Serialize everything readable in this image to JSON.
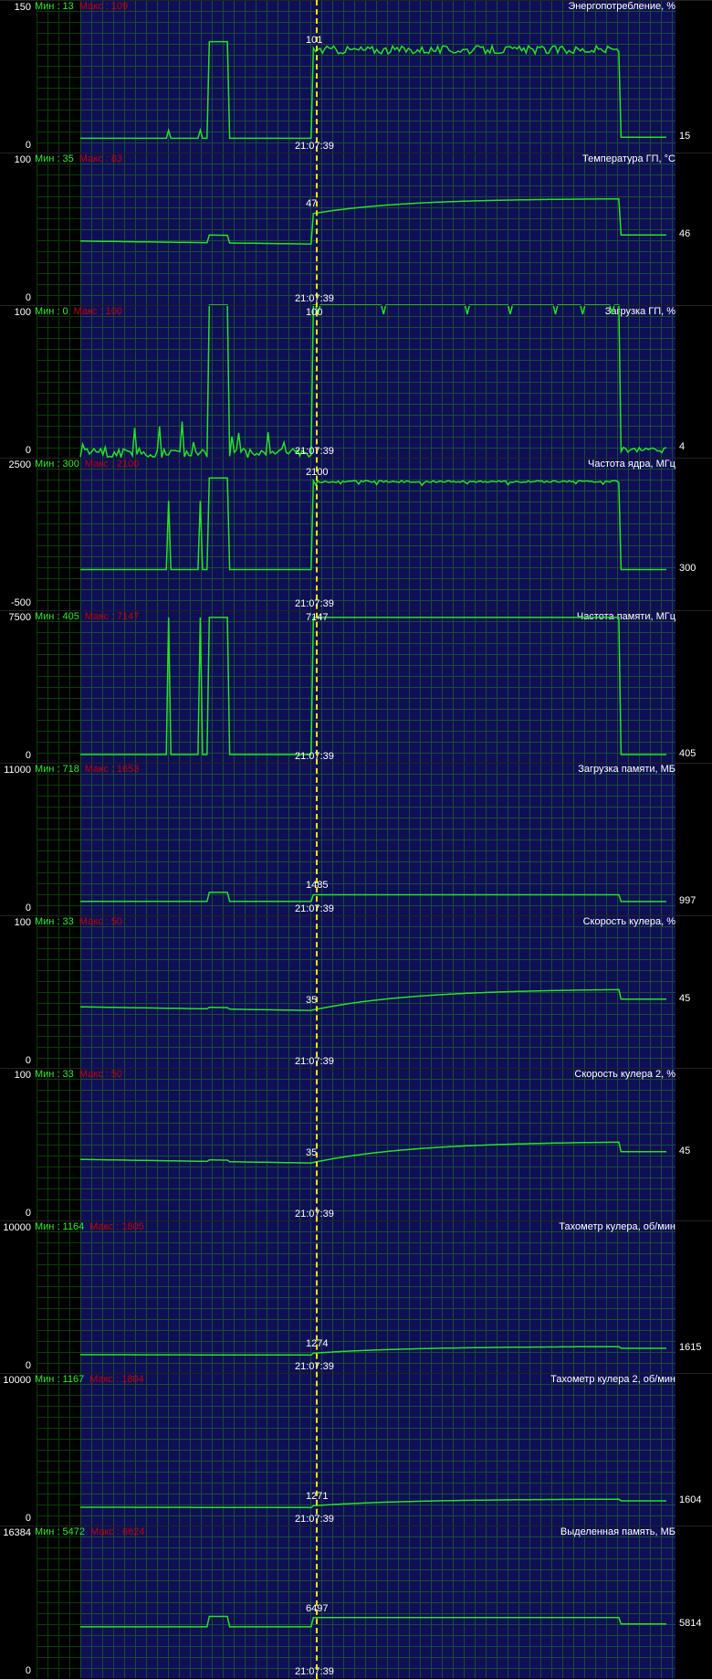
{
  "time_label": "21:07:39",
  "colors": {
    "line": "#24e224",
    "cursor": "#f2e600",
    "min": "#2ee82e",
    "max": "#c00000"
  },
  "panels": [
    {
      "key": "power",
      "title": "Энергопотребление, %",
      "min_label": "Мин : 13",
      "max_label": "Макс : 109",
      "ymax": "150",
      "ymin": "0",
      "current": "15",
      "cursor_value": "101",
      "scale": [
        0,
        150
      ],
      "profile": "power"
    },
    {
      "key": "temp",
      "title": "Температура ГП, °C",
      "min_label": "Мин : 35",
      "max_label": "Макс : 83",
      "ymax": "100",
      "ymin": "0",
      "current": "46",
      "cursor_value": "47",
      "scale": [
        0,
        100
      ],
      "profile": "temp"
    },
    {
      "key": "gpuload",
      "title": "Загрузка ГП, %",
      "min_label": "Мин : 0",
      "max_label": "Макс : 100",
      "ymax": "100",
      "ymin": "0",
      "current": "4",
      "cursor_value": "100",
      "scale": [
        0,
        100
      ],
      "profile": "gpuload"
    },
    {
      "key": "coreclk",
      "title": "Частота ядра, МГц",
      "min_label": "Мин : 300",
      "max_label": "Макс : 2100",
      "ymax": "2500",
      "ymin": "-500",
      "current": "300",
      "cursor_value": "2100",
      "scale": [
        -500,
        2500
      ],
      "profile": "coreclk"
    },
    {
      "key": "memclk",
      "title": "Частота памяти, МГц",
      "min_label": "Мин : 405",
      "max_label": "Макс : 7147",
      "ymax": "7500",
      "ymin": "0",
      "current": "405",
      "cursor_value": "7147",
      "scale": [
        0,
        7500
      ],
      "profile": "memclk"
    },
    {
      "key": "memload",
      "title": "Загрузка памяти, МБ",
      "min_label": "Мин : 718",
      "max_label": "Макс : 1653",
      "ymax": "11000",
      "ymin": "0",
      "current": "997",
      "cursor_value": "1485",
      "scale": [
        0,
        11000
      ],
      "profile": "memload"
    },
    {
      "key": "fan1",
      "title": "Скорость кулера, %",
      "min_label": "Мин : 33",
      "max_label": "Макс : 50",
      "ymax": "100",
      "ymin": "0",
      "current": "45",
      "cursor_value": "35",
      "scale": [
        0,
        100
      ],
      "profile": "fan"
    },
    {
      "key": "fan2",
      "title": "Скорость кулера 2, %",
      "min_label": "Мин : 33",
      "max_label": "Макс : 50",
      "ymax": "100",
      "ymin": "0",
      "current": "45",
      "cursor_value": "35",
      "scale": [
        0,
        100
      ],
      "profile": "fan"
    },
    {
      "key": "rpm1",
      "title": "Тахометр кулера, об/мин",
      "min_label": "Мин : 1164",
      "max_label": "Макс : 1805",
      "ymax": "10000",
      "ymin": "0",
      "current": "1615",
      "cursor_value": "1274",
      "scale": [
        0,
        10000
      ],
      "profile": "rpm"
    },
    {
      "key": "rpm2",
      "title": "Тахометр кулера 2, об/мин",
      "min_label": "Мин : 1167",
      "max_label": "Макс : 1804",
      "ymax": "10000",
      "ymin": "0",
      "current": "1604",
      "cursor_value": "1271",
      "scale": [
        0,
        10000
      ],
      "profile": "rpm"
    },
    {
      "key": "dedmem",
      "title": "Выделенная память, МБ",
      "min_label": "Мин : 5472",
      "max_label": "Макс : 6624",
      "ymax": "16384",
      "ymin": "0",
      "current": "5814",
      "cursor_value": "6497",
      "scale": [
        0,
        16384
      ],
      "profile": "dedmem"
    }
  ]
}
